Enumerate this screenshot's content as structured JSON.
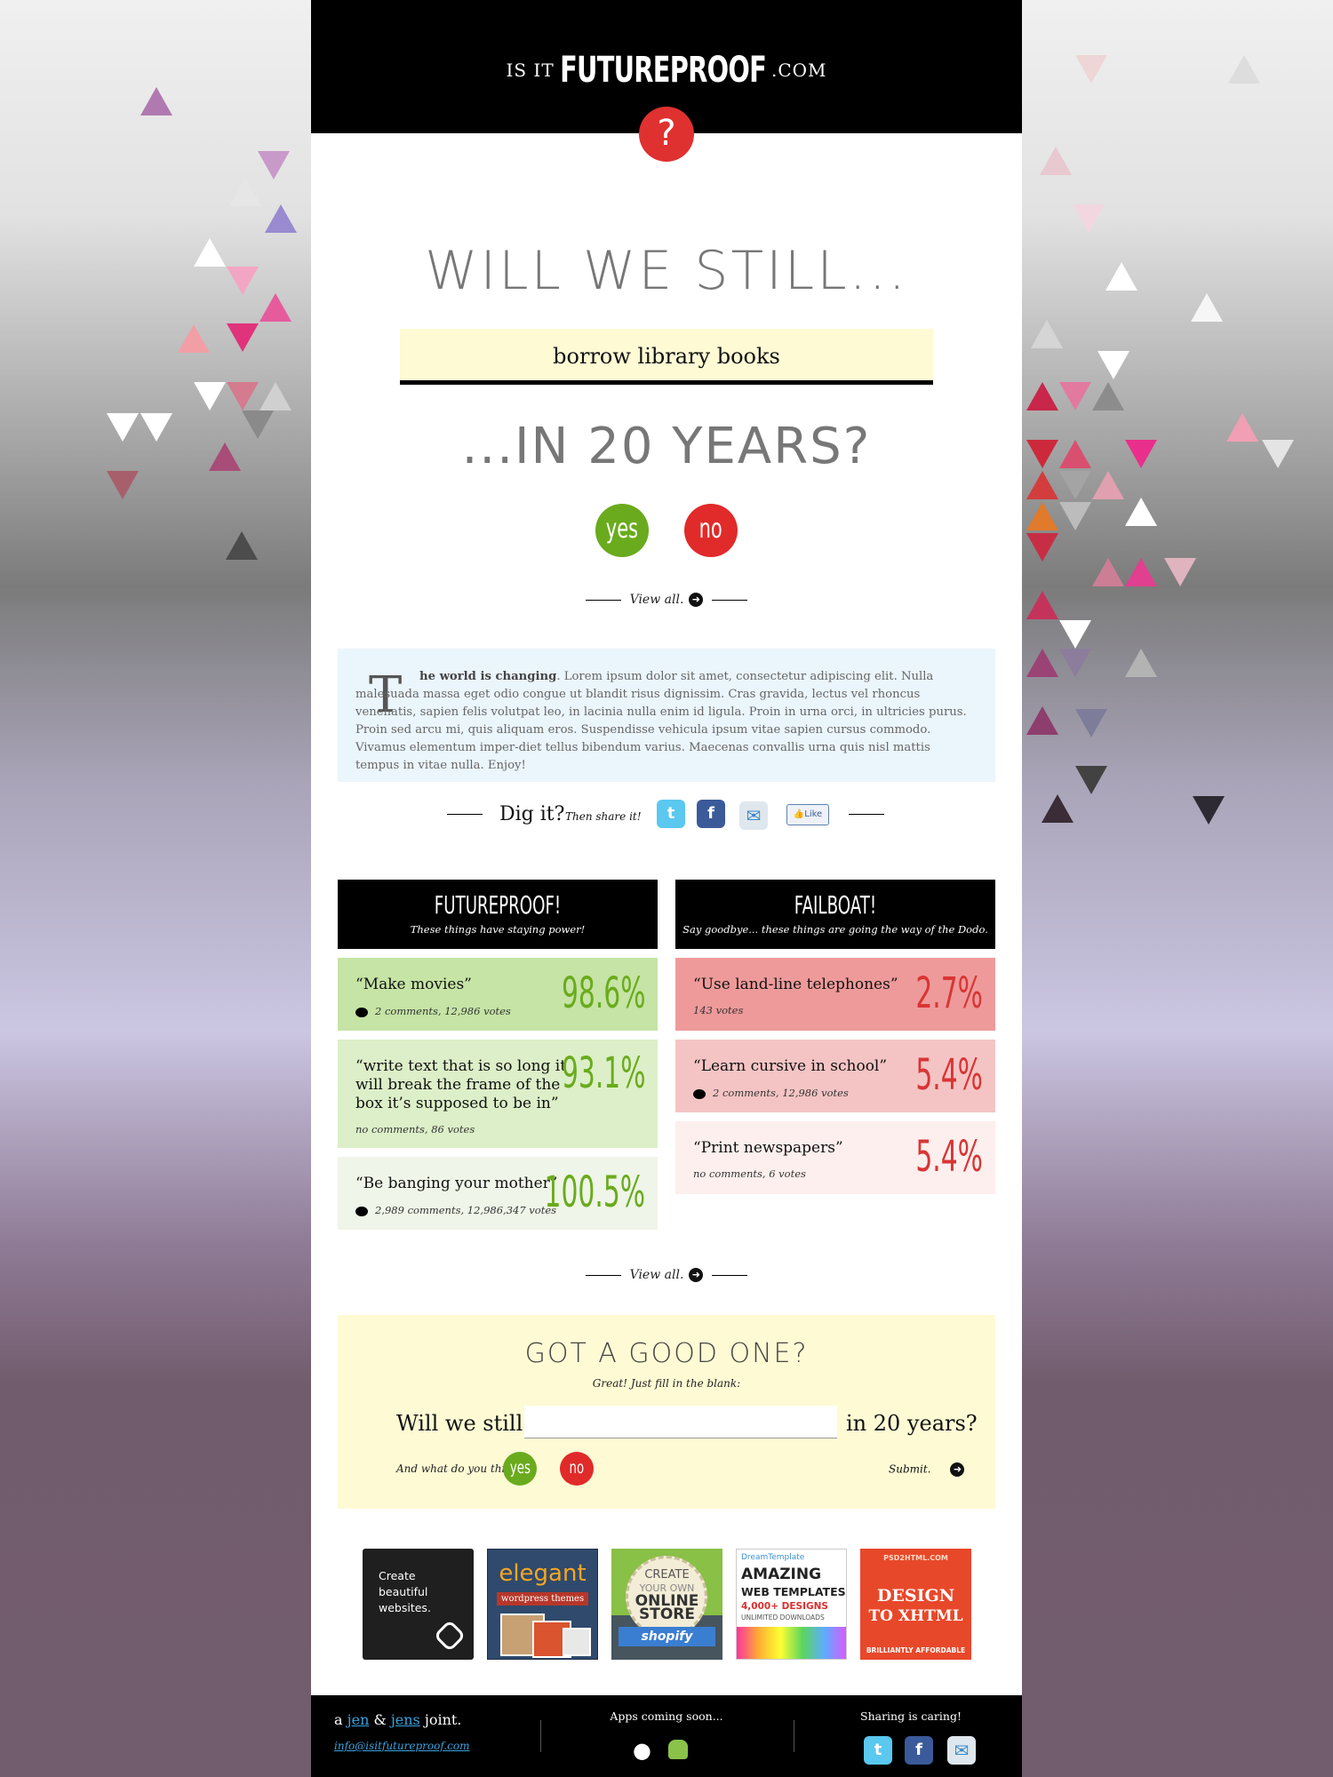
{
  "header": {
    "prefix": "IS IT",
    "brand": "FUTUREPROOF",
    "suffix": ".COM",
    "badge": "?"
  },
  "question": {
    "heading_top": "WILL WE STILL...",
    "blank_value": "borrow library books",
    "heading_bottom": "...IN 20 YEARS?",
    "yes_label": "yes",
    "no_label": "no"
  },
  "view_all": {
    "label": "View all."
  },
  "intro": {
    "drop_cap": "T",
    "lead": "he world is changing",
    "body": ". Lorem ipsum dolor sit amet, consectetur adipiscing elit. Nulla malesuada massa eget odio congue ut blandit risus dignissim. Cras gravida, lectus vel rhoncus venenatis, sapien felis volutpat leo, in lacinia nulla enim id ligula. Proin in urna orci, in ultricies purus. Proin sed arcu mi, quis aliquam eros. Suspendisse vehicula ipsum vitae sapien cursus commodo. Vivamus elementum imper-diet tellus bibendum varius. Maecenas convallis urna quis nisl mattis tempus in vitae nulla. Enjoy!"
  },
  "share": {
    "title": "Dig it?",
    "subtitle": "Then share it!",
    "like_label": "Like",
    "icons": [
      "twitter-icon",
      "facebook-icon",
      "email-icon",
      "like-icon"
    ]
  },
  "futureproof": {
    "title": "FUTUREPROOF!",
    "subtitle": "These things have staying power!",
    "items": [
      {
        "quote": "“Make movies”",
        "meta": "2 comments, 12,986 votes",
        "pct": "98.6%",
        "bg": "#c5e4a5"
      },
      {
        "quote": "“write text that is so long it will break the frame of the box it’s supposed to be in”",
        "meta": "no comments, 86 votes",
        "pct": "93.1%",
        "bg": "#dcefc8"
      },
      {
        "quote": "“Be banging your mother”",
        "meta": "2,989 comments, 12,986,347 votes",
        "pct": "100.5%",
        "bg": "#eff5e8"
      }
    ]
  },
  "failboat": {
    "title": "FAILBOAT!",
    "subtitle": "Say goodbye... these things are going the way of the Dodo.",
    "items": [
      {
        "quote": "“Use land-line telephones”",
        "meta": "143 votes",
        "pct": "2.7%",
        "bg": "#ee9a9a"
      },
      {
        "quote": "“Learn cursive in school”",
        "meta": "2 comments, 12,986 votes",
        "pct": "5.4%",
        "bg": "#f4c4c4"
      },
      {
        "quote": "“Print newspapers”",
        "meta": "no comments, 6 votes",
        "pct": "5.4%",
        "bg": "#fcefee"
      }
    ]
  },
  "submit_form": {
    "heading": "GOT A GOOD ONE?",
    "subheading": "Great! Just fill in the blank:",
    "prefix": "Will we still",
    "input_value": "",
    "suffix": "in 20 years?",
    "think": "And what do you think?",
    "yes_label": "yes",
    "no_label": "no",
    "submit_label": "Submit."
  },
  "ads": {
    "squarespace": {
      "line1": "Create",
      "line2": "beautiful",
      "line3": "websites."
    },
    "elegant": {
      "title": "elegant",
      "sub": "wordpress themes"
    },
    "shopify": {
      "l1": "CREATE",
      "l2": "YOUR OWN",
      "l3": "ONLINE",
      "l4": "STORE",
      "brand": "shopify"
    },
    "dreamtemplate": {
      "brand": "DreamTemplate",
      "l1": "AMAZING",
      "l2": "WEB TEMPLATES",
      "l3": "4,000+ DESIGNS",
      "l4": "UNLIMITED DOWNLOADS"
    },
    "psd2html": {
      "top": "PSD2HTML.COM",
      "l1": "DESIGN",
      "l2": "TO XHTML",
      "bottom": "BRILLIANTLY AFFORDABLE"
    }
  },
  "footer": {
    "a": "a",
    "jen": "jen",
    "amp": "&",
    "jens": "jens",
    "joint": "joint.",
    "email": "info@isitfutureproof.com",
    "apps_title": "Apps coming soon...",
    "sharing_title": "Sharing is caring!"
  },
  "colors": {
    "yes": "#6aab1d",
    "no": "#e12a2a",
    "blank_bg": "#fdfad4",
    "intro_bg": "#ebf5fc"
  }
}
